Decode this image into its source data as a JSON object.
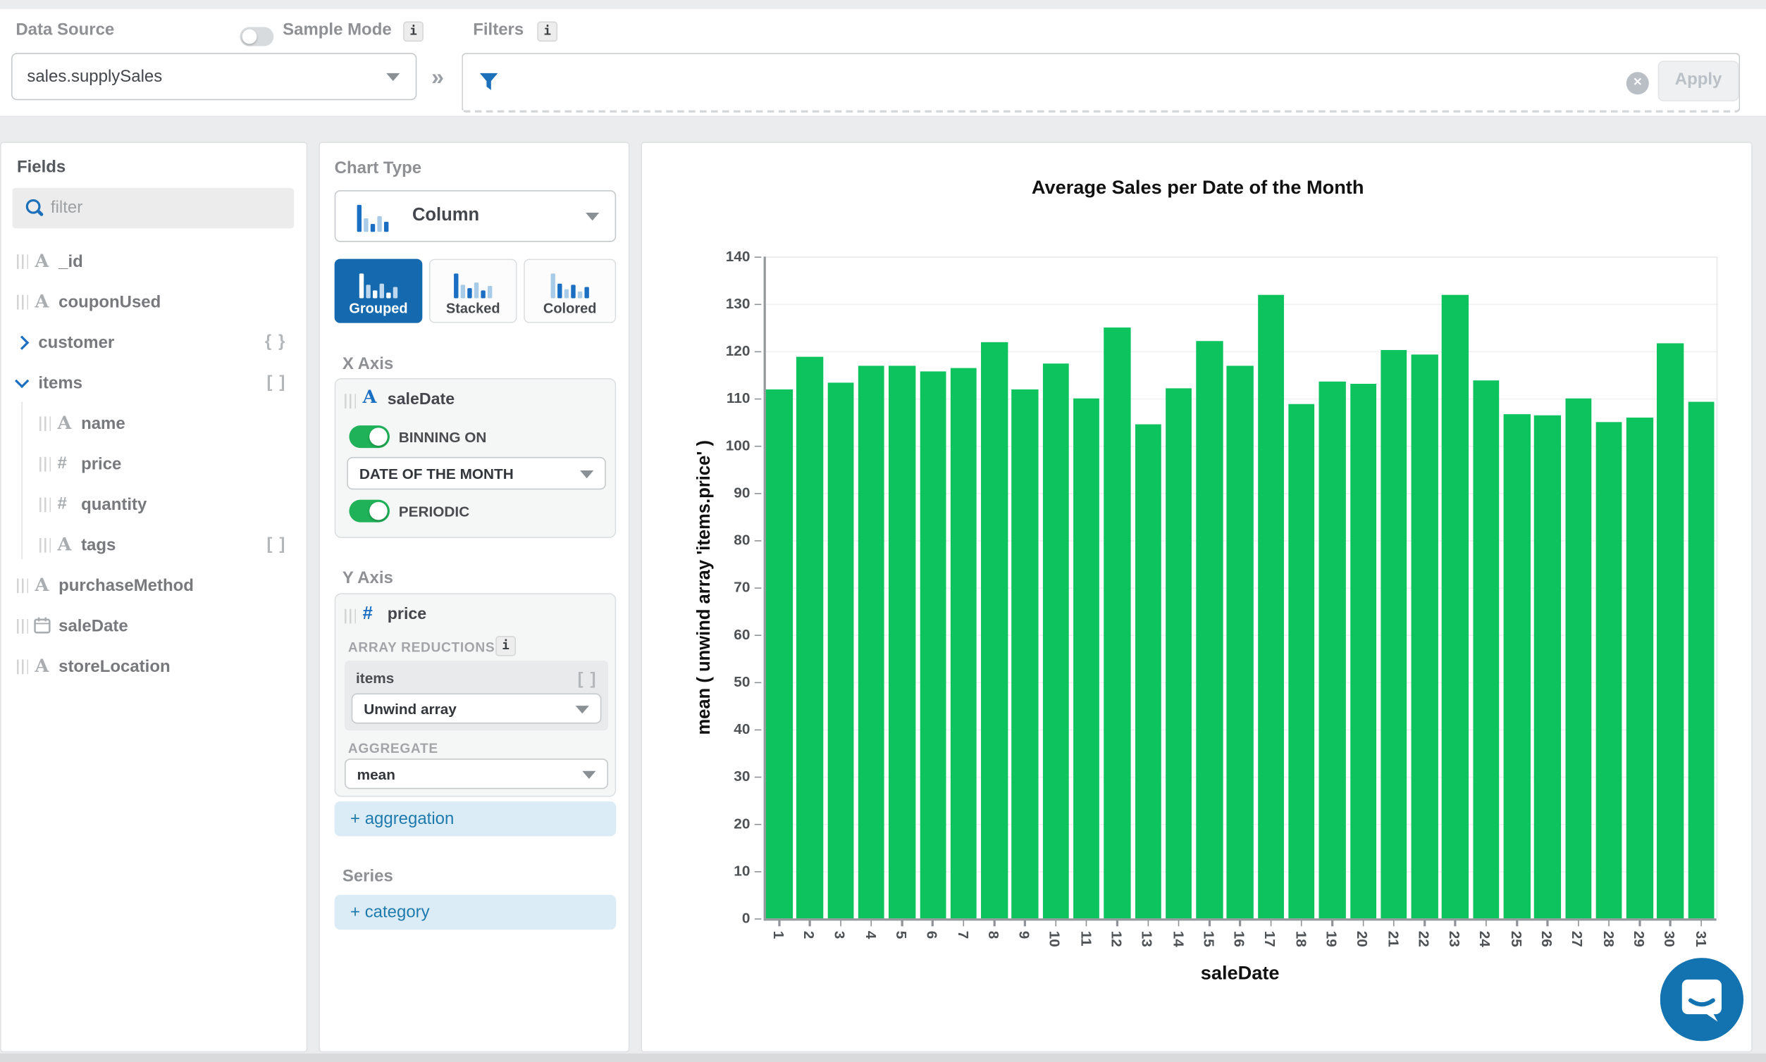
{
  "ui": {
    "info_glyph": "i",
    "chevrons_glyph": "»",
    "clear_glyph": "✕"
  },
  "colors": {
    "accent_blue": "#1569ae",
    "icon_blue": "#1b6fc2",
    "link_blue": "#1f7bad",
    "toggle_green": "#1fb258",
    "bar_green": "#0cc35e",
    "intercom_blue": "#1273b0"
  },
  "topbar": {
    "data_source_label": "Data Source",
    "data_source_value": "sales.supplySales",
    "sample_mode_label": "Sample Mode",
    "sample_mode_on": false,
    "filters_label": "Filters",
    "apply_label": "Apply"
  },
  "fields": {
    "title": "Fields",
    "filter_placeholder": "filter",
    "items": [
      {
        "name": "_id",
        "icon": "string",
        "indent": 0,
        "chevron": "",
        "badge": ""
      },
      {
        "name": "couponUsed",
        "icon": "string",
        "indent": 0,
        "chevron": "",
        "badge": ""
      },
      {
        "name": "customer",
        "icon": "",
        "indent": 0,
        "chevron": "right",
        "badge": "{ }"
      },
      {
        "name": "items",
        "icon": "",
        "indent": 0,
        "chevron": "down",
        "badge": "[ ]"
      },
      {
        "name": "name",
        "icon": "string",
        "indent": 1,
        "chevron": "",
        "badge": ""
      },
      {
        "name": "price",
        "icon": "number",
        "indent": 1,
        "chevron": "",
        "badge": ""
      },
      {
        "name": "quantity",
        "icon": "number",
        "indent": 1,
        "chevron": "",
        "badge": ""
      },
      {
        "name": "tags",
        "icon": "string",
        "indent": 1,
        "chevron": "",
        "badge": "[ ]"
      },
      {
        "name": "purchaseMethod",
        "icon": "string",
        "indent": 0,
        "chevron": "",
        "badge": ""
      },
      {
        "name": "saleDate",
        "icon": "date",
        "indent": 0,
        "chevron": "",
        "badge": ""
      },
      {
        "name": "storeLocation",
        "icon": "string",
        "indent": 0,
        "chevron": "",
        "badge": ""
      }
    ]
  },
  "builder": {
    "chart_type_label": "Chart Type",
    "chart_type_value": "Column",
    "modes": [
      "Grouped",
      "Stacked",
      "Colored"
    ],
    "active_mode": "Grouped",
    "x_axis": {
      "label": "X Axis",
      "field": "saleDate",
      "binning_label": "BINNING ON",
      "binning_on": true,
      "bin_value": "DATE OF THE MONTH",
      "periodic_label": "PERIODIC",
      "periodic_on": true
    },
    "y_axis": {
      "label": "Y Axis",
      "field": "price",
      "array_reductions_label": "ARRAY REDUCTIONS",
      "reduction_field": "items",
      "reduction_badge": "[ ]",
      "reduction_value": "Unwind array",
      "aggregate_label": "AGGREGATE",
      "aggregate_value": "mean",
      "add_aggregation_label": "+ aggregation"
    },
    "series_label": "Series",
    "add_category_label": "+ category"
  },
  "chart_data": {
    "type": "bar",
    "title": "Average Sales per Date of the Month",
    "xlabel": "saleDate",
    "ylabel": "mean ( unwind array 'items.price' )",
    "categories": [
      "1",
      "2",
      "3",
      "4",
      "5",
      "6",
      "7",
      "8",
      "9",
      "10",
      "11",
      "12",
      "13",
      "14",
      "15",
      "16",
      "17",
      "18",
      "19",
      "20",
      "21",
      "22",
      "23",
      "24",
      "25",
      "26",
      "27",
      "28",
      "29",
      "30",
      "31"
    ],
    "values": [
      111.8,
      118.9,
      113.4,
      117.0,
      117.0,
      115.8,
      116.4,
      122.0,
      112.0,
      117.4,
      110.0,
      125.0,
      104.5,
      112.1,
      122.1,
      117.0,
      131.8,
      108.8,
      113.5,
      113.0,
      120.3,
      119.2,
      131.9,
      113.9,
      106.7,
      106.4,
      110.0,
      104.9,
      105.9,
      121.7,
      109.4
    ],
    "ylim": [
      0,
      140
    ],
    "ytick_step": 10,
    "grid": true,
    "legend": false
  }
}
